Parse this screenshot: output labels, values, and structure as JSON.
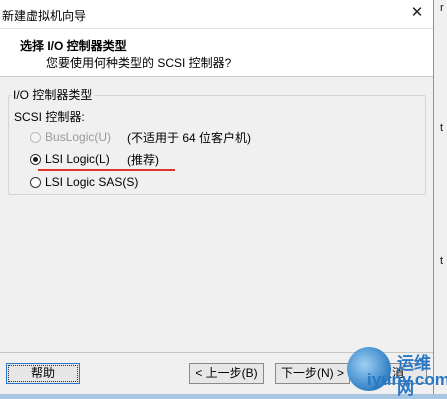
{
  "window": {
    "title": "新建虚拟机向导",
    "close_glyph": "✕"
  },
  "header": {
    "title": "选择 I/O 控制器类型",
    "subtitle": "您要使用何种类型的 SCSI 控制器?"
  },
  "group": {
    "legend": "I/O 控制器类型",
    "label": "SCSI 控制器:",
    "options": [
      {
        "label": "BusLogic(U)",
        "note": "(不适用于 64 位客户机)",
        "selected": false,
        "enabled": false
      },
      {
        "label": "LSI Logic(L)",
        "note": "(推荐)",
        "selected": true,
        "enabled": true
      },
      {
        "label": "LSI Logic SAS(S)",
        "note": "",
        "selected": false,
        "enabled": true
      }
    ]
  },
  "buttons": {
    "help": "帮助",
    "back": "< 上一步(B)",
    "next": "下一步(N) >",
    "cancel": "取消"
  },
  "background_fragments": [
    "r",
    "t",
    "t"
  ],
  "watermark": {
    "cn": "运维网",
    "en": "iyunv.com"
  },
  "colors": {
    "annotation_underline": "#e0342a",
    "focus_border": "#2a74c9",
    "desktop": "#a9c6e0"
  }
}
